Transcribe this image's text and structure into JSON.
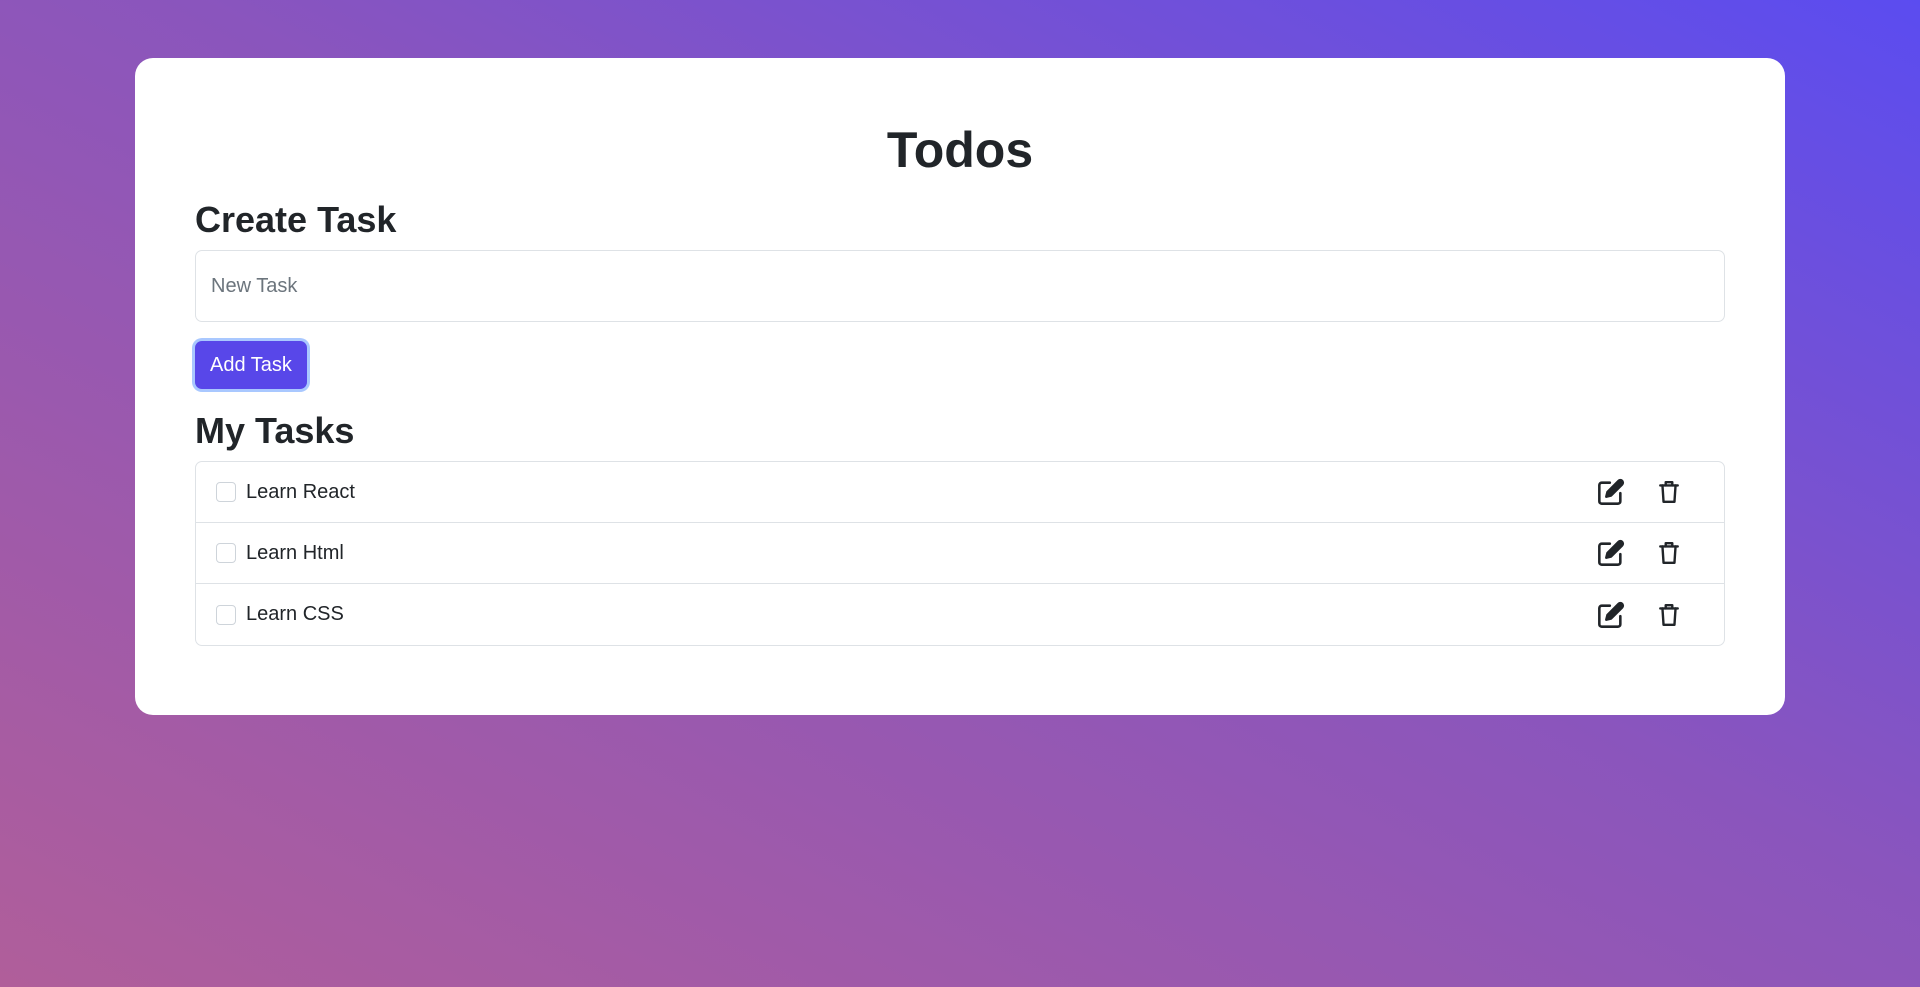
{
  "app": {
    "title": "Todos"
  },
  "create": {
    "heading": "Create Task",
    "input_value": "",
    "input_placeholder": "New Task",
    "button_label": "Add Task"
  },
  "tasks": {
    "heading": "My Tasks",
    "items": [
      {
        "label": "Learn React",
        "completed": false,
        "edit_icon": "edit-icon",
        "delete_icon": "trash-icon"
      },
      {
        "label": "Learn Html",
        "completed": false,
        "edit_icon": "edit-icon",
        "delete_icon": "trash-icon"
      },
      {
        "label": "Learn CSS",
        "completed": false,
        "edit_icon": "edit-icon",
        "delete_icon": "trash-icon"
      }
    ]
  },
  "colors": {
    "accent": "#5847e9",
    "focus_ring": "#a9c8ff",
    "background_start": "#b05e9a",
    "background_end": "#5b4cf0"
  }
}
